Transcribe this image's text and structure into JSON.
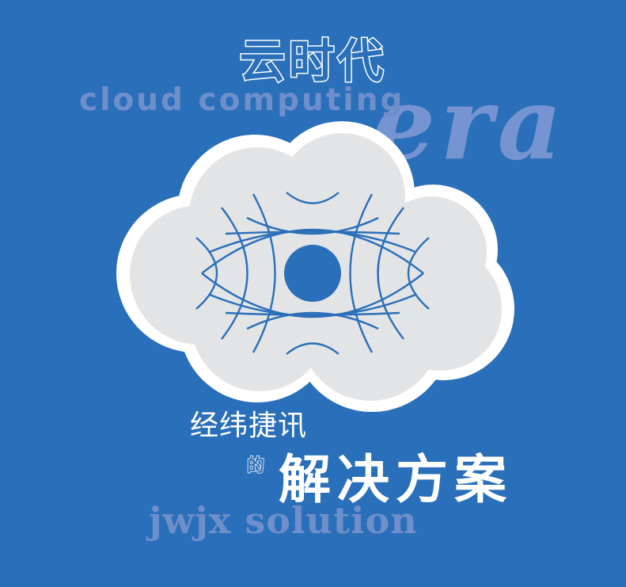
{
  "title": {
    "cn": "云时代",
    "en": "cloud computing",
    "era": "era"
  },
  "brand": {
    "cn": "经纬捷讯",
    "de": "的"
  },
  "solution": {
    "cn": "解决方案",
    "en": "jwjx solution"
  },
  "colors": {
    "background": "#2a6fb9",
    "cloud_outline": "#ffffff",
    "cloud_fill": "#e3e4e6",
    "faded_text": "#6f8fcb",
    "graphic": "#2a6fb9"
  },
  "icons": [
    "cloud-icon",
    "globe-eye-icon"
  ]
}
